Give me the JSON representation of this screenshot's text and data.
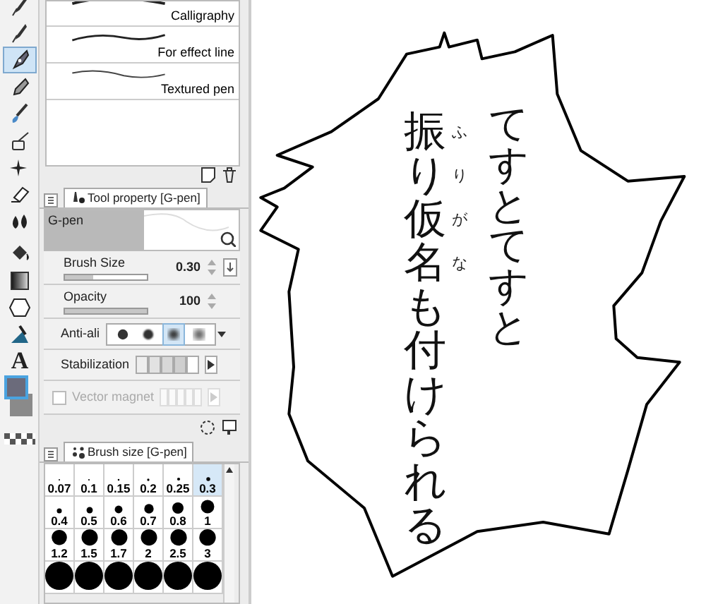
{
  "toolbar": {
    "tools": [
      {
        "kind": "pen",
        "selected": false
      },
      {
        "kind": "pen",
        "selected": false
      },
      {
        "kind": "gpen",
        "selected": true
      },
      {
        "kind": "marker",
        "selected": false
      },
      {
        "kind": "brush",
        "selected": false
      },
      {
        "kind": "ink",
        "selected": false
      },
      {
        "kind": "sparkle",
        "selected": false
      },
      {
        "kind": "eraser",
        "selected": false
      },
      {
        "kind": "drops",
        "selected": false
      },
      {
        "kind": "bucket",
        "selected": false
      },
      {
        "kind": "gradient",
        "selected": false
      },
      {
        "kind": "hexagon",
        "selected": false
      },
      {
        "kind": "figure",
        "selected": false
      },
      {
        "kind": "text",
        "glyph": "A",
        "selected": false
      },
      {
        "kind": "colors",
        "selected": false
      },
      {
        "kind": "checker",
        "selected": false
      }
    ]
  },
  "brush_list": {
    "items": [
      {
        "name": "Calligraphy"
      },
      {
        "name": "For effect line"
      },
      {
        "name": "Textured pen"
      }
    ]
  },
  "tool_property": {
    "title": "Tool property [G-pen]",
    "preset": "G-pen",
    "properties": [
      {
        "kind": "slider",
        "label": "Brush Size",
        "value": "0.30",
        "level": 0.35,
        "pressure_button": true
      },
      {
        "kind": "slider",
        "label": "Opacity",
        "value": "100",
        "level": 1.0,
        "pressure_button": false
      },
      {
        "kind": "choice",
        "label": "Anti-ali",
        "options": [
          {
            "selected": false
          },
          {
            "selected": false
          },
          {
            "selected": true
          },
          {
            "selected": false
          }
        ]
      },
      {
        "kind": "segments",
        "label": "Stabilization",
        "disabled": false
      },
      {
        "kind": "checkbox",
        "label": "Vector magnet",
        "checked": false,
        "disabled": true
      }
    ]
  },
  "brush_size": {
    "title": "Brush size [G-pen]",
    "sizes": [
      {
        "label": "0.07",
        "selected": false
      },
      {
        "label": "0.1",
        "selected": false
      },
      {
        "label": "0.15",
        "selected": false
      },
      {
        "label": "0.2",
        "selected": false
      },
      {
        "label": "0.25",
        "selected": false
      },
      {
        "label": "0.3",
        "selected": true
      },
      {
        "label": "0.4",
        "selected": false
      },
      {
        "label": "0.5",
        "selected": false
      },
      {
        "label": "0.6",
        "selected": false
      },
      {
        "label": "0.7",
        "selected": false
      },
      {
        "label": "0.8",
        "selected": false
      },
      {
        "label": "1",
        "selected": false
      },
      {
        "label": "1.2",
        "selected": false
      },
      {
        "label": "1.5",
        "selected": false
      },
      {
        "label": "1.7",
        "selected": false
      },
      {
        "label": "2",
        "selected": false
      },
      {
        "label": "2.5",
        "selected": false
      },
      {
        "label": "3",
        "selected": false
      },
      {
        "selected": false
      },
      {
        "selected": false
      },
      {
        "selected": false
      },
      {
        "selected": false
      },
      {
        "selected": false
      },
      {
        "selected": false
      }
    ]
  },
  "canvas": {
    "balloon": {
      "line_1": "てすとてすと",
      "line_2": [
        {
          "base": "振り",
          "ruby": "ふり"
        },
        {
          "base": "仮名",
          "ruby": "がな"
        },
        {
          "base": "も付けられる"
        }
      ]
    }
  }
}
